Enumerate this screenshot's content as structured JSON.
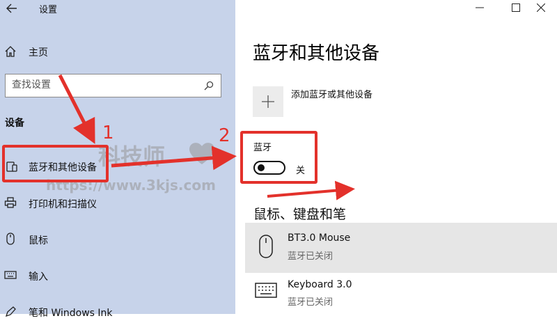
{
  "window": {
    "title": "设置"
  },
  "sidebar": {
    "home_label": "主页",
    "search": {
      "placeholder": "查找设置"
    },
    "section_title": "设备",
    "items": [
      {
        "label": "蓝牙和其他设备",
        "icon": "bluetooth-devices-icon"
      },
      {
        "label": "打印机和扫描仪",
        "icon": "printer-icon"
      },
      {
        "label": "鼠标",
        "icon": "mouse-icon"
      },
      {
        "label": "输入",
        "icon": "keyboard-icon"
      },
      {
        "label": "笔和 Windows Ink",
        "icon": "pen-icon"
      }
    ]
  },
  "main": {
    "title": "蓝牙和其他设备",
    "add_device_label": "添加蓝牙或其他设备",
    "bluetooth": {
      "label": "蓝牙",
      "state_label": "关",
      "on": false
    },
    "devices_section_title": "鼠标、键盘和笔",
    "devices": [
      {
        "name": "BT3.0 Mouse",
        "status": "蓝牙已关闭",
        "icon": "mouse-icon"
      },
      {
        "name": "Keyboard 3.0",
        "status": "蓝牙已关闭",
        "icon": "keyboard-icon"
      }
    ]
  },
  "annotations": {
    "step1": "1",
    "step2": "2"
  },
  "watermark": {
    "name": "科技师",
    "url": "https://www.3kjs.com"
  },
  "colors": {
    "sidebar_bg": "#c7d3ea",
    "annotation_red": "#e3312b",
    "selected_row": "#e6e6e6"
  }
}
